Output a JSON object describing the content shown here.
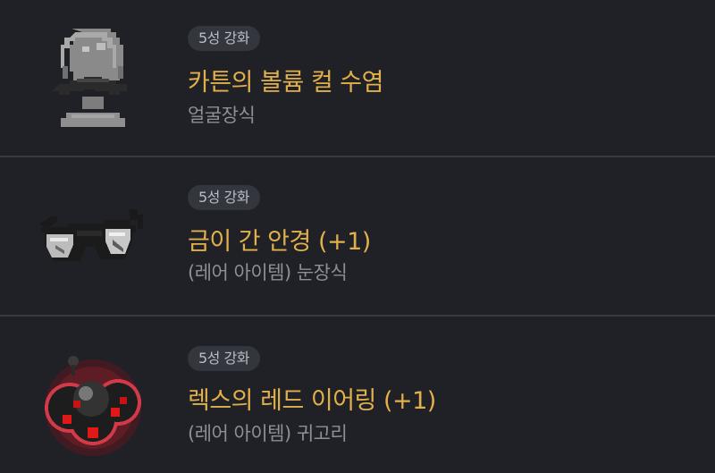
{
  "items": [
    {
      "badge": "5성 강화",
      "name": "카튼의 볼륨 컬 수염",
      "category": "얼굴장식",
      "icon": "beard-mannequin-icon"
    },
    {
      "badge": "5성 강화",
      "name": "금이 간 안경 (+1)",
      "category": "(레어 아이템) 눈장식",
      "icon": "cracked-glasses-icon"
    },
    {
      "badge": "5성 강화",
      "name": "렉스의 레드 이어링 (+1)",
      "category": "(레어 아이템) 귀고리",
      "icon": "red-earring-icon"
    }
  ],
  "colors": {
    "background": "#202126",
    "item_name": "#e2b04a",
    "badge_bg": "#34363d",
    "badge_text": "#b9bcc6",
    "subtext": "#8d8f97",
    "divider": "#393a40"
  }
}
